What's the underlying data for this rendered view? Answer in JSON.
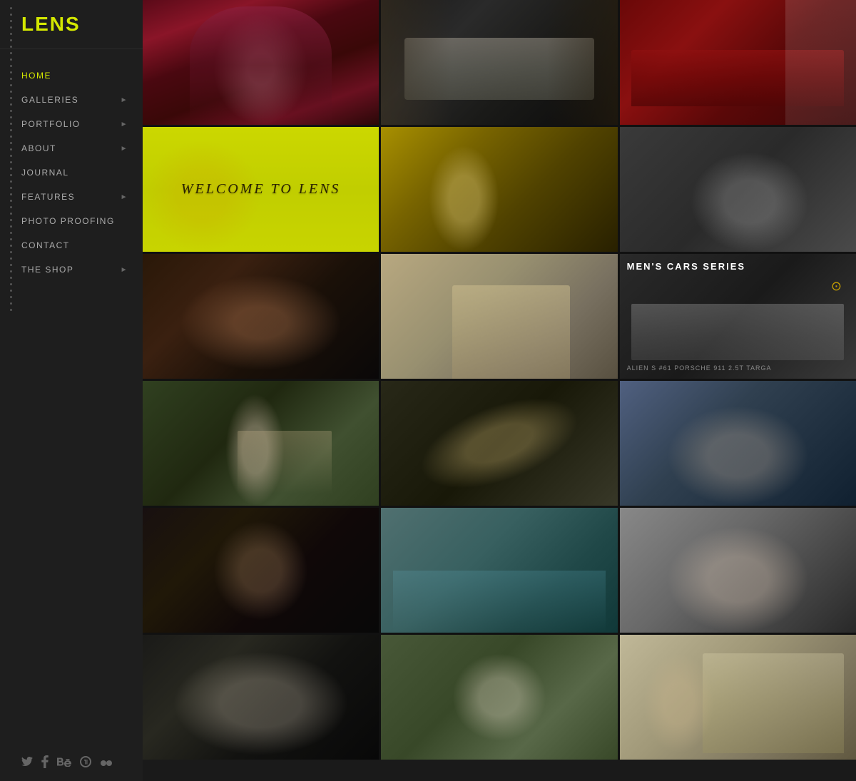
{
  "sidebar": {
    "logo": "LENS",
    "nav_items": [
      {
        "label": "HOME",
        "has_arrow": false,
        "active": true,
        "id": "home"
      },
      {
        "label": "GALLERIES",
        "has_arrow": true,
        "active": false,
        "id": "galleries"
      },
      {
        "label": "PORTFOLIO",
        "has_arrow": true,
        "active": false,
        "id": "portfolio"
      },
      {
        "label": "ABOUT",
        "has_arrow": true,
        "active": false,
        "id": "about"
      },
      {
        "label": "JOURNAL",
        "has_arrow": false,
        "active": false,
        "id": "journal"
      },
      {
        "label": "FEATURES",
        "has_arrow": true,
        "active": false,
        "id": "features"
      },
      {
        "label": "PHOTO PROOFING",
        "has_arrow": false,
        "active": false,
        "id": "photo-proofing"
      },
      {
        "label": "CONTACT",
        "has_arrow": false,
        "active": false,
        "id": "contact"
      },
      {
        "label": "THE SHOP",
        "has_arrow": true,
        "active": false,
        "id": "the-shop"
      }
    ],
    "social_icons": [
      "twitter",
      "facebook",
      "behance",
      "500px",
      "flickr"
    ]
  },
  "grid": {
    "welcome_text": "WELCOME TO LENS",
    "mens_cars_title": "MEN'S CARS SERIES",
    "car_subtitle": "ALIEN S #61 PORSCHE 911 2.5T TARGA"
  }
}
